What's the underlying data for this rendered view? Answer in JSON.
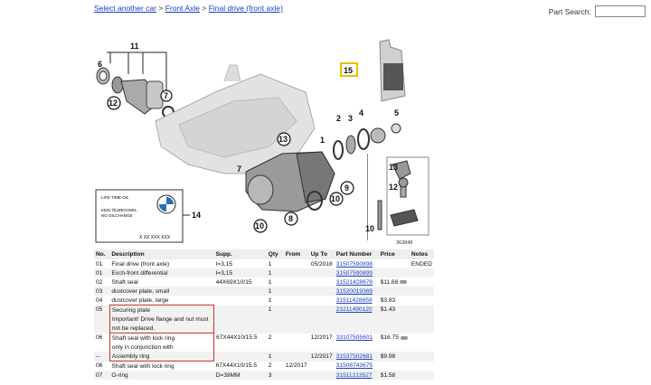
{
  "breadcrumb": {
    "items": [
      "Select another car",
      "Front Axle",
      "Final drive (front axle)"
    ],
    "separator": ">"
  },
  "search": {
    "label": "Part Search:",
    "value": ""
  },
  "diagram": {
    "callouts": [
      "11",
      "6",
      "7",
      "12",
      "15",
      "13",
      "1",
      "2",
      "3",
      "4",
      "5",
      "7",
      "9",
      "10",
      "8",
      "10",
      "14",
      "13",
      "12",
      "10"
    ],
    "sticker": {
      "line1": "LIFE-TIME-OIL",
      "line2": "KEIN ÖLWECHSEL",
      "line3": "NO OILCHANGE",
      "code": "X XX XXX XXX"
    },
    "figure_id": "363848"
  },
  "table": {
    "headers": [
      "No.",
      "Description",
      "Supp.",
      "Qty",
      "From",
      "Up To",
      "Part Number",
      "Price",
      "Notes"
    ],
    "rows": [
      {
        "no": "01",
        "desc": "Final drive (front axle)",
        "supp": "I=3,15",
        "qty": "1",
        "from": "",
        "upto": "05/2018",
        "part": "31507590898",
        "price": "",
        "notes": "ENDED"
      },
      {
        "no": "01",
        "desc": "Exch-front differential",
        "supp": "I=3,15",
        "qty": "1",
        "from": "",
        "upto": "",
        "part": "31507590899",
        "price": "",
        "notes": ""
      },
      {
        "no": "02",
        "desc": "Shaft seal",
        "supp": "44X69X10/15",
        "qty": "1",
        "from": "",
        "upto": "",
        "part": "31521428678",
        "price": "$11.68",
        "notes": ""
      },
      {
        "no": "03",
        "desc": "dustcover plate, small",
        "supp": "",
        "qty": "1",
        "from": "",
        "upto": "",
        "part": "31520019369",
        "price": "",
        "notes": ""
      },
      {
        "no": "04",
        "desc": "dustcover plate, large",
        "supp": "",
        "qty": "1",
        "from": "",
        "upto": "",
        "part": "31511428659",
        "price": "$3.83",
        "notes": ""
      },
      {
        "no": "05",
        "desc": "Securing plate",
        "supp": "",
        "qty": "1",
        "from": "",
        "upto": "",
        "part": "23211490120",
        "price": "$1.43",
        "notes": ""
      },
      {
        "no": "",
        "desc": "Important! Drive flange and nut must",
        "supp": "",
        "qty": "",
        "from": "",
        "upto": "",
        "part": "",
        "price": "",
        "notes": ""
      },
      {
        "no": "",
        "desc": "not be replaced.",
        "supp": "",
        "qty": "",
        "from": "",
        "upto": "",
        "part": "",
        "price": "",
        "notes": ""
      },
      {
        "no": "06",
        "desc": "Shaft seal with lock ring",
        "supp": "67X44X10/15.5",
        "qty": "2",
        "from": "",
        "upto": "12/2017",
        "part": "33107505601",
        "price": "$16.75",
        "notes": ""
      },
      {
        "no": "",
        "desc": "only in conjunction with",
        "supp": "",
        "qty": "",
        "from": "",
        "upto": "",
        "part": "",
        "price": "",
        "notes": ""
      },
      {
        "no": "--",
        "desc": "Assembly ring",
        "supp": "",
        "qty": "1",
        "from": "",
        "upto": "12/2017",
        "part": "31537502681",
        "price": "$9.98",
        "notes": ""
      },
      {
        "no": "06",
        "desc": "Shaft seal with lock ring",
        "supp": "67X44X10/15.5",
        "qty": "2",
        "from": "12/2017",
        "upto": "",
        "part": "31508743675",
        "price": "",
        "notes": ""
      },
      {
        "no": "07",
        "desc": "O-ring",
        "supp": "D=39MM",
        "qty": "3",
        "from": "",
        "upto": "",
        "part": "31511213527",
        "price": "$1.58",
        "notes": ""
      }
    ]
  }
}
